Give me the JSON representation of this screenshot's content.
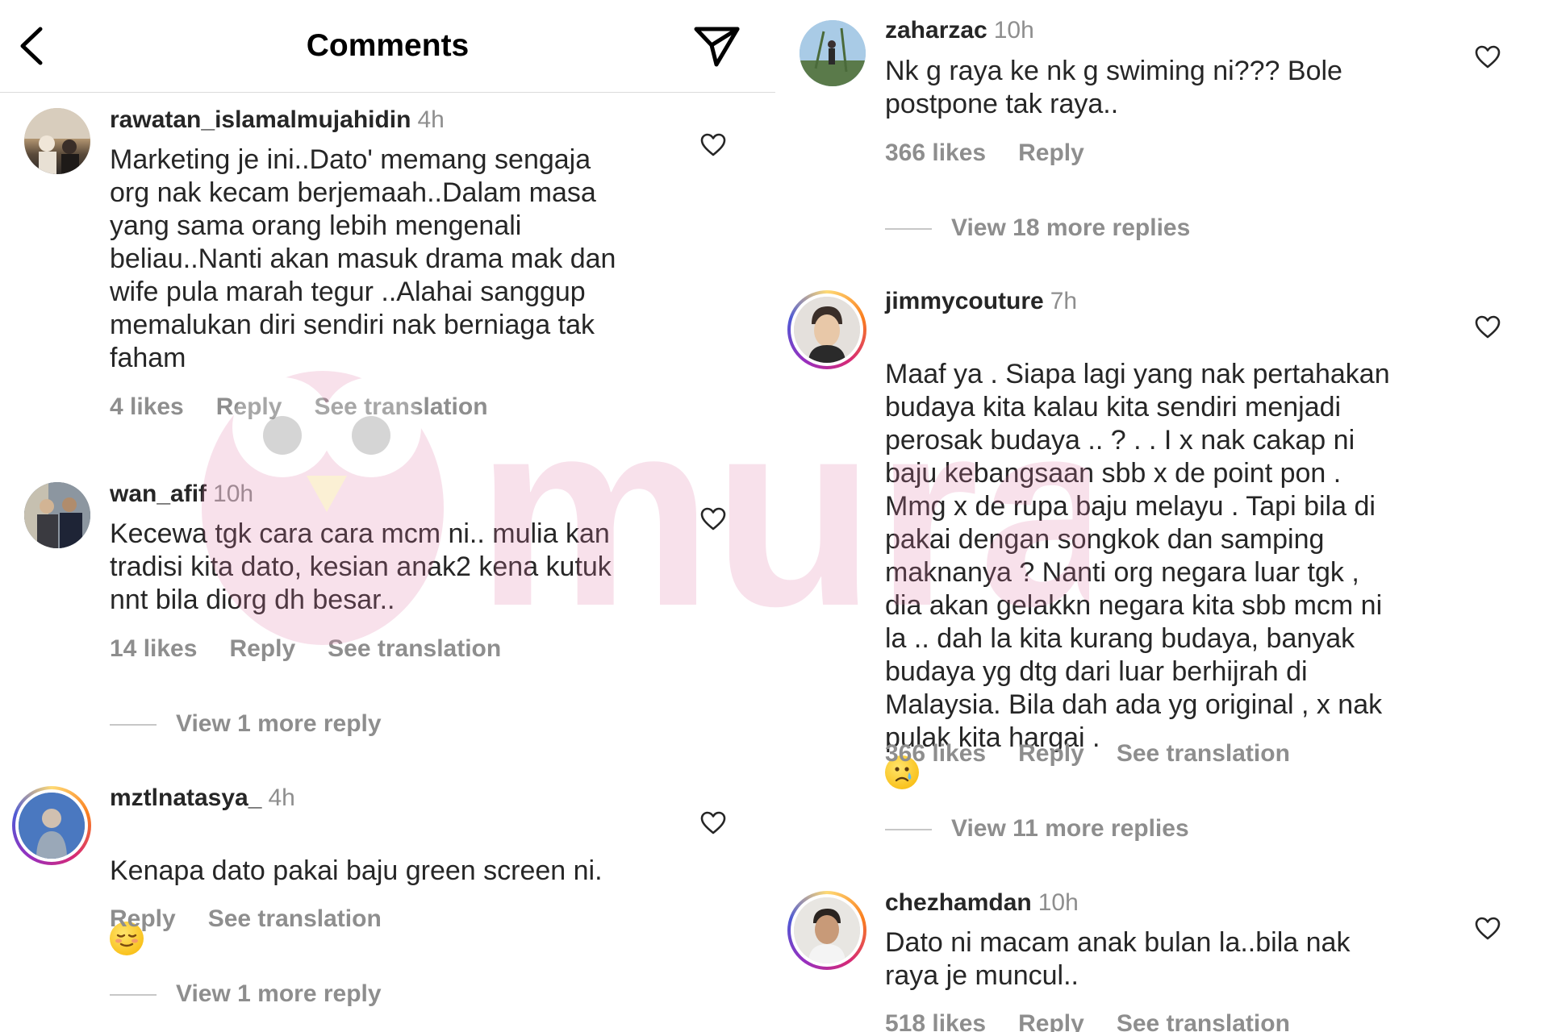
{
  "header": {
    "title": "Comments",
    "back_icon": "chevron-left-icon",
    "send_icon": "send-icon"
  },
  "left_comments": [
    {
      "username": "rawatan_islamalmujahidin",
      "time": "4h",
      "text": "Marketing je ini..Dato' memang sengaja\norg nak kecam berjemaah..Dalam masa\nyang sama orang lebih mengenali\nbeliau..Nanti akan masuk drama mak dan\nwife pula marah tegur ..Alahai sanggup\nmemalukan diri sendiri nak berniaga tak\nfaham",
      "likes": "4 likes",
      "reply": "Reply",
      "see_translation": "See translation"
    },
    {
      "username": "wan_afif",
      "time": "10h",
      "text": "Kecewa tgk cara cara mcm ni.. mulia kan\ntradisi kita dato, kesian anak2 kena kutuk\nnnt bila diorg dh besar..",
      "likes": "14 likes",
      "reply": "Reply",
      "see_translation": "See translation",
      "view_more": "View 1 more reply"
    },
    {
      "username": "mztlnatasya_",
      "time": "4h",
      "text": "Kenapa dato pakai baju green screen ni.",
      "emoji": "relieved-face-emoji",
      "reply": "Reply",
      "see_translation": "See translation",
      "view_more": "View 1 more reply"
    }
  ],
  "right_comments": [
    {
      "username": "zaharzac",
      "time": "10h",
      "text": "Nk g raya ke nk g swiming ni??? Bole\npostpone tak raya..",
      "likes": "366 likes",
      "reply": "Reply",
      "view_more": "View 18 more replies"
    },
    {
      "username": "jimmycouture",
      "time": "7h",
      "text": "Maaf ya . Siapa lagi yang nak pertahakan\nbudaya kita kalau kita sendiri menjadi\nperosak budaya .. ? . . I x nak cakap ni\nbaju kebangsaan sbb x de point pon .\nMmg x de rupa baju melayu . Tapi bila di\npakai dengan songkok dan samping\nmaknanya ? Nanti org negara luar tgk ,\ndia akan gelakkn negara kita sbb mcm ni\nla .. dah la kita kurang budaya, banyak\nbudaya yg dtg dari luar berhijrah di\nMalaysia. Bila dah ada yg original , x nak\npulak kita hargai .",
      "emoji": "crying-face-emoji",
      "likes": "366 likes",
      "reply": "Reply",
      "see_translation": "See translation",
      "view_more": "View 11 more replies"
    },
    {
      "username": "chezhamdan",
      "time": "10h",
      "text": "Dato ni macam anak bulan la..bila nak\nraya je muncul..",
      "likes": "518 likes",
      "reply": "Reply",
      "see_translation": "See translation"
    }
  ],
  "watermark": "murai",
  "colors": {
    "text": "#262626",
    "secondary": "#8e8e8e",
    "divider": "#dbdbdb"
  }
}
